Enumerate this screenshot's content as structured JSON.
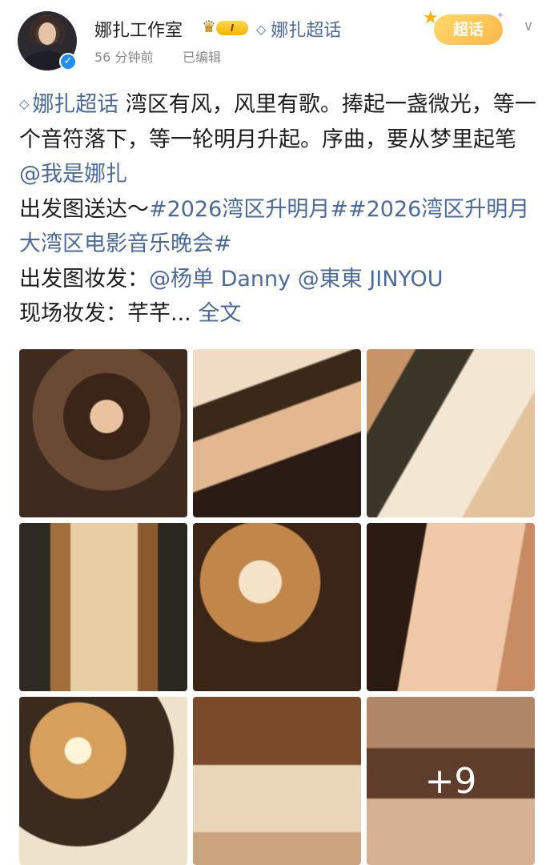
{
  "header": {
    "name": "娜扎工作室",
    "badge_level": "I",
    "topic_link": "娜扎超话",
    "time": "56 分钟前",
    "edited": "已编辑",
    "supertopic_badge": "超话"
  },
  "post": {
    "topic_tag": "娜扎超话",
    "text_1": "湾区有风，风里有歌。捧起一盏微光，等一个音符落下，等一轮明月升起。序曲，要从梦里起笔",
    "mention_1": "@我是娜扎",
    "text_2": "出发图送达～",
    "hashtag_1": "#2026湾区升明月#",
    "hashtag_2": "#2026湾区升明月大湾区电影音乐晚会#",
    "text_3": "出发图妆发：",
    "mention_2": "@杨单 Danny",
    "mention_3": "@東東 JINYOU",
    "text_4": "现场妆发：芊芊...",
    "full_text_link": "全文"
  },
  "images": {
    "more_count": "+9"
  },
  "colors": {
    "link": "#4a6a9c",
    "verified": "#1f8ff0",
    "badge_gold": "#f5b400"
  }
}
